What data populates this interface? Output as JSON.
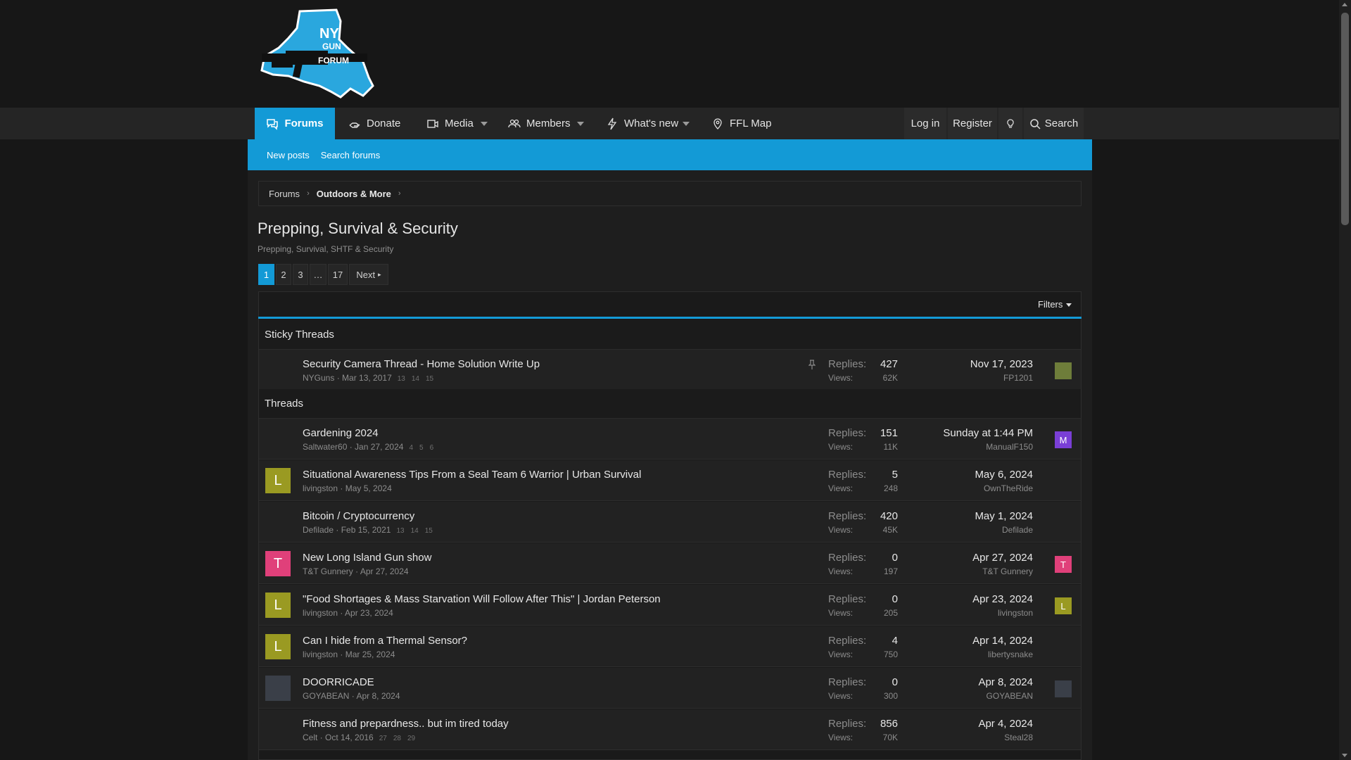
{
  "colors": {
    "accent": "#139ad6",
    "background": "#171717",
    "panel": "#222222"
  },
  "nav": {
    "items": [
      {
        "label": "Forums",
        "icon": "forums-icon"
      },
      {
        "label": "Donate",
        "icon": "donate-icon"
      },
      {
        "label": "Media",
        "icon": "media-icon"
      },
      {
        "label": "Members",
        "icon": "members-icon"
      },
      {
        "label": "What's new",
        "icon": "bolt-icon"
      },
      {
        "label": "FFL Map",
        "icon": "map-pin-icon"
      }
    ],
    "login": "Log in",
    "register": "Register",
    "search": "Search"
  },
  "subnav": {
    "new_posts": "New posts",
    "search_forums": "Search forums"
  },
  "breadcrumb": {
    "home": "Forums",
    "parent": "Outdoors & More"
  },
  "page": {
    "title": "Prepping, Survival & Security",
    "description": "Prepping, Survival, SHTF & Security"
  },
  "pagination": {
    "pages": [
      "1",
      "2",
      "3",
      "…",
      "17"
    ],
    "next": "Next"
  },
  "filters": "Filters",
  "labels": {
    "replies": "Replies:",
    "views": "Views:"
  },
  "sections": {
    "sticky": "Sticky Threads",
    "threads": "Threads"
  },
  "sticky_threads": [
    {
      "title": "Security Camera Thread - Home Solution Write Up",
      "author": "NYGuns",
      "started": "Mar 13, 2017",
      "pages": [
        "13",
        "14",
        "15"
      ],
      "replies": "427",
      "views": "62K",
      "last_date": "Nov 17, 2023",
      "last_user": "FP1201",
      "avatar_letter": "",
      "avatar_color": "",
      "last_avatar_letter": "",
      "last_avatar_color": "#6e7d3a"
    }
  ],
  "threads": [
    {
      "title": "Gardening 2024",
      "author": "Saltwater60",
      "started": "Jan 27, 2024",
      "pages": [
        "4",
        "5",
        "6"
      ],
      "replies": "151",
      "views": "11K",
      "last_date": "Sunday at 1:44 PM",
      "last_user": "ManualF150",
      "avatar_letter": "",
      "avatar_color": "",
      "last_avatar_letter": "M",
      "last_avatar_color": "#7a3fd6"
    },
    {
      "title": "Situational Awareness Tips From a Seal Team 6 Warrior | Urban Survival",
      "author": "livingston",
      "started": "May 5, 2024",
      "pages": [],
      "replies": "5",
      "views": "248",
      "last_date": "May 6, 2024",
      "last_user": "OwnTheRide",
      "avatar_letter": "L",
      "avatar_color": "#9a9a22",
      "last_avatar_letter": "",
      "last_avatar_color": ""
    },
    {
      "title": "Bitcoin / Cryptocurrency",
      "author": "Defilade",
      "started": "Feb 15, 2021",
      "pages": [
        "13",
        "14",
        "15"
      ],
      "replies": "420",
      "views": "45K",
      "last_date": "May 1, 2024",
      "last_user": "Defilade",
      "avatar_letter": "",
      "avatar_color": "",
      "last_avatar_letter": "",
      "last_avatar_color": ""
    },
    {
      "title": "New Long Island Gun show",
      "author": "T&T Gunnery",
      "started": "Apr 27, 2024",
      "pages": [],
      "replies": "0",
      "views": "197",
      "last_date": "Apr 27, 2024",
      "last_user": "T&T Gunnery",
      "avatar_letter": "T",
      "avatar_color": "#e0407a",
      "last_avatar_letter": "T",
      "last_avatar_color": "#e0407a"
    },
    {
      "title": "\"Food Shortages & Mass Starvation Will Follow After This\" | Jordan Peterson",
      "author": "livingston",
      "started": "Apr 23, 2024",
      "pages": [],
      "replies": "0",
      "views": "205",
      "last_date": "Apr 23, 2024",
      "last_user": "livingston",
      "avatar_letter": "L",
      "avatar_color": "#9a9a22",
      "last_avatar_letter": "L",
      "last_avatar_color": "#9a9a22"
    },
    {
      "title": "Can I hide from a Thermal Sensor?",
      "author": "livingston",
      "started": "Mar 25, 2024",
      "pages": [],
      "replies": "4",
      "views": "750",
      "last_date": "Apr 14, 2024",
      "last_user": "libertysnake",
      "avatar_letter": "L",
      "avatar_color": "#9a9a22",
      "last_avatar_letter": "",
      "last_avatar_color": ""
    },
    {
      "title": "DOORRICADE",
      "author": "GOYABEAN",
      "started": "Apr 8, 2024",
      "pages": [],
      "replies": "0",
      "views": "300",
      "last_date": "Apr 8, 2024",
      "last_user": "GOYABEAN",
      "avatar_letter": "",
      "avatar_color": "#3a3f48",
      "last_avatar_letter": "",
      "last_avatar_color": "#3a3f48"
    },
    {
      "title": "Fitness and prepardness.. but im tired today",
      "author": "Celt",
      "started": "Oct 14, 2016",
      "pages": [
        "27",
        "28",
        "29"
      ],
      "replies": "856",
      "views": "70K",
      "last_date": "Apr 4, 2024",
      "last_user": "Steal28",
      "avatar_letter": "",
      "avatar_color": "",
      "last_avatar_letter": "",
      "last_avatar_color": ""
    }
  ]
}
